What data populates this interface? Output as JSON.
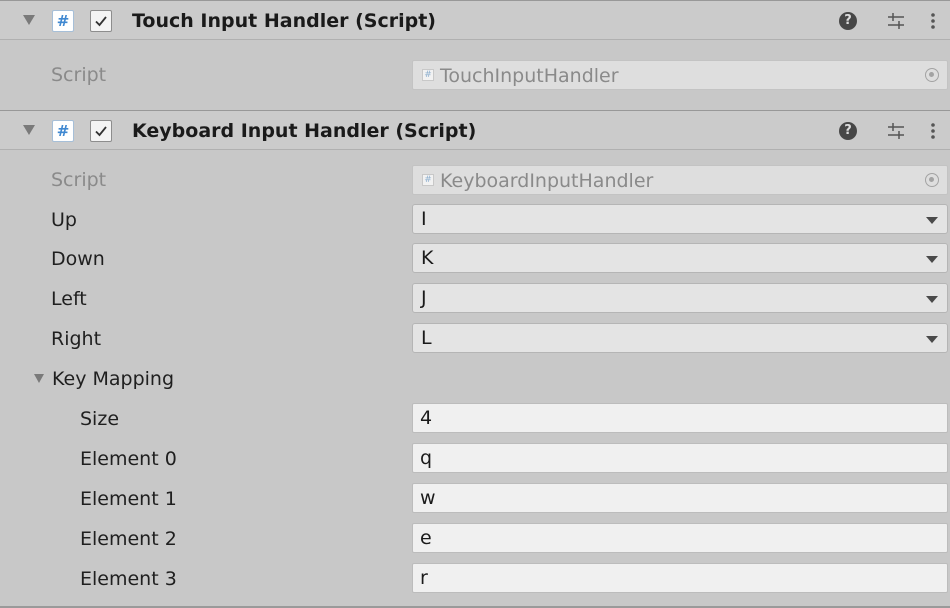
{
  "components": [
    {
      "title": "Touch Input Handler (Script)",
      "script_label": "Script",
      "script_value": "TouchInputHandler"
    },
    {
      "title": "Keyboard Input Handler (Script)",
      "script_label": "Script",
      "script_value": "KeyboardInputHandler",
      "properties": [
        {
          "label": "Up",
          "value": "I"
        },
        {
          "label": "Down",
          "value": "K"
        },
        {
          "label": "Left",
          "value": "J"
        },
        {
          "label": "Right",
          "value": "L"
        }
      ],
      "key_mapping": {
        "label": "Key Mapping",
        "size_label": "Size",
        "size_value": "4",
        "elements": [
          {
            "label": "Element 0",
            "value": "q"
          },
          {
            "label": "Element 1",
            "value": "w"
          },
          {
            "label": "Element 2",
            "value": "e"
          },
          {
            "label": "Element 3",
            "value": "r"
          }
        ]
      }
    }
  ],
  "icons": {
    "foldout": "foldout-arrow-icon",
    "script": "script-icon",
    "checkbox": "checkmark-icon",
    "help": "help-icon",
    "presets": "presets-icon",
    "menu": "kebab-menu-icon",
    "object_picker": "object-picker-icon",
    "dropdown": "dropdown-arrow-icon"
  },
  "colors": {
    "background": "#c8c8c8",
    "header": "#cbcbcb",
    "script_icon_accent": "#3f88d1",
    "disabled_text": "#8a8a8a"
  }
}
